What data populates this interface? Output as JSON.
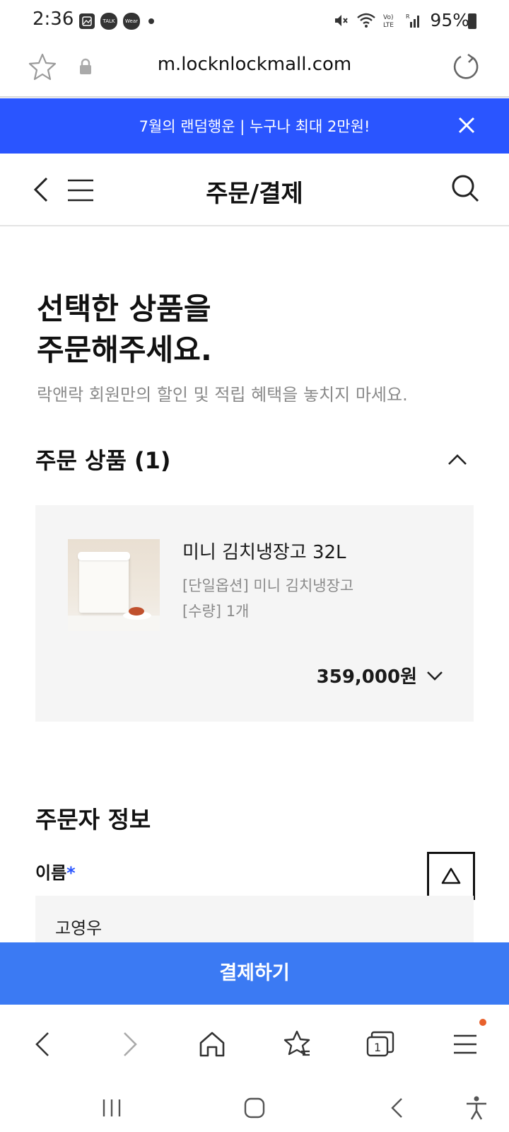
{
  "status_bar": {
    "time": "2:36",
    "left_icons": [
      "gallery-icon",
      "talk-icon",
      "wear-icon",
      "dot-icon"
    ],
    "left_icon_labels": {
      "talk": "TALK",
      "wear": "Wear"
    },
    "right_icons": [
      "mute-icon",
      "wifi-icon",
      "volte-icon",
      "signal-icon",
      "battery-icon"
    ],
    "battery_percent": "95%"
  },
  "browser": {
    "url": "m.locknlockmall.com"
  },
  "promo": {
    "text": "7월의 랜덤행운 |  누구나 최대 2만원!",
    "color": "#2a55ff"
  },
  "header": {
    "title": "주문/결제"
  },
  "headline": {
    "line1": "선택한 상품을",
    "line2": "주문해주세요.",
    "sub": "락앤락 회원만의 할인 및 적립 혜택을 놓치지 마세요."
  },
  "order_section": {
    "title": "주문 상품 (1)",
    "item": {
      "name": "미니 김치냉장고 32L",
      "option": "[단일옵션] 미니 김치냉장고",
      "quantity": "[수량] 1개",
      "price": "359,000원"
    }
  },
  "orderer": {
    "title": "주문자 정보",
    "name_label": "이름",
    "required_mark": "*",
    "name_value": "고영우"
  },
  "pay_button": {
    "label": "결제하기",
    "color": "#3b7af3"
  }
}
